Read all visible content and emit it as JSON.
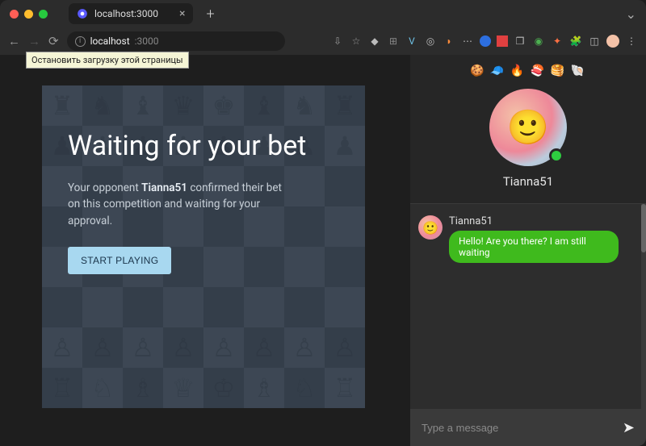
{
  "browser": {
    "tab_title": "localhost:3000",
    "url_host": "localhost",
    "url_port": ":3000",
    "tooltip": "Остановить загрузку этой страницы"
  },
  "overlay": {
    "title": "Waiting for your bet",
    "body_before": "Your opponent ",
    "body_name": "Tianna51",
    "body_after": " confirmed their bet on this competition and waiting for your approval.",
    "button": "START PLAYING"
  },
  "profile": {
    "emojis": "🍪 🧢 🔥 🍣 🥞 🐚",
    "name": "Tianna51"
  },
  "chat": {
    "sender": "Tianna51",
    "message": "Hello! Are you there? I am still waiting",
    "placeholder": "Type a message"
  },
  "board": {
    "pieces": [
      [
        "♜",
        "♞",
        "♝",
        "♛",
        "♚",
        "♝",
        "♞",
        "♜"
      ],
      [
        "♟",
        "♟",
        "♟",
        "♟",
        "♟",
        "♟",
        "♟",
        "♟"
      ],
      [
        "",
        "",
        "",
        "",
        "",
        "",
        "",
        ""
      ],
      [
        "",
        "",
        "",
        "",
        "",
        "",
        "",
        ""
      ],
      [
        "",
        "",
        "",
        "",
        "",
        "",
        "",
        ""
      ],
      [
        "",
        "",
        "",
        "",
        "",
        "",
        "",
        ""
      ],
      [
        "♙",
        "♙",
        "♙",
        "♙",
        "♙",
        "♙",
        "♙",
        "♙"
      ],
      [
        "♖",
        "♘",
        "♗",
        "♕",
        "♔",
        "♗",
        "♘",
        "♖"
      ]
    ]
  }
}
